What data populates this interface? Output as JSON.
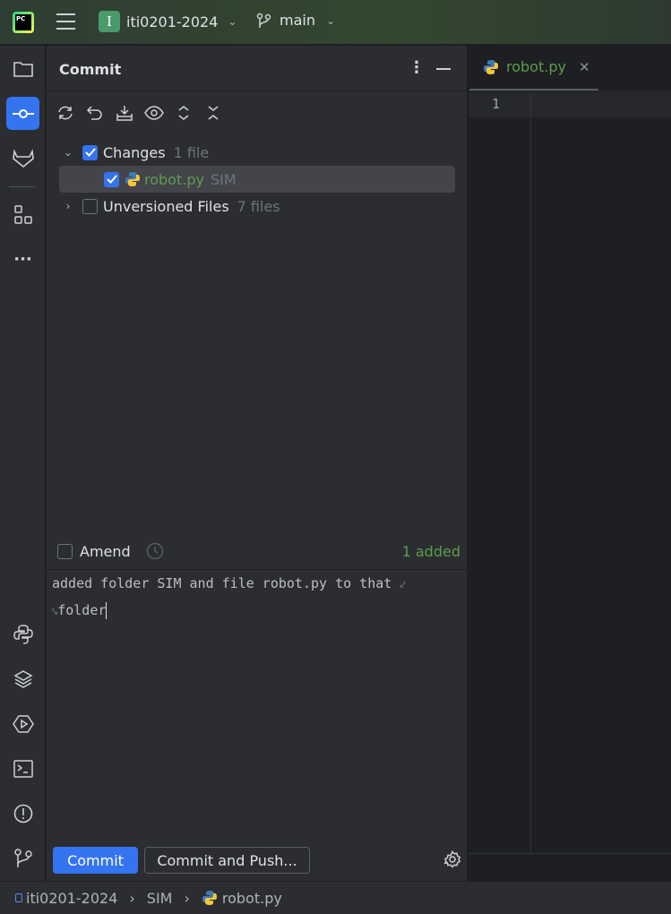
{
  "topbar": {
    "project_letter": "I",
    "project": "iti0201-2024",
    "branch": "main",
    "logo_text": "PC"
  },
  "sidebar": {
    "icons": [
      "folder-icon",
      "commit-icon",
      "gitlab-icon",
      "structure-icon",
      "more-icon",
      "python-console-icon",
      "layers-icon",
      "run-icon",
      "terminal-icon",
      "problems-icon",
      "git-icon"
    ],
    "active": "commit-icon",
    "accent": "#3574f0"
  },
  "panel": {
    "title": "Commit",
    "tree": [
      {
        "label": "Changes",
        "count": "1 file",
        "checked": true,
        "expanded": true
      },
      {
        "label": "robot.py",
        "count": "SIM",
        "checked": true,
        "selected": true
      },
      {
        "label": "Unversioned Files",
        "count": "7 files",
        "checked": false,
        "expanded": false
      }
    ],
    "amend_label": "Amend",
    "added": "1 added",
    "message_line1": "added folder SIM and file robot.py to that ",
    "message_line2": "folder",
    "commit_label": "Commit",
    "commit_push_label": "Commit and Push..."
  },
  "editor": {
    "tab": "robot.py",
    "line_number": "1"
  },
  "statusbar": {
    "crumbs": [
      "iti0201-2024",
      "SIM",
      "robot.py"
    ]
  }
}
